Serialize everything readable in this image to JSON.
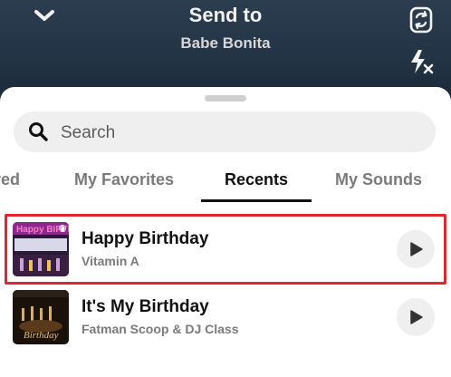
{
  "header": {
    "title": "Send to",
    "subtitle": "Babe Bonita",
    "icons": [
      "chevron-down-icon",
      "flip-camera-icon",
      "flash-off-icon"
    ]
  },
  "search": {
    "placeholder": "Search",
    "value": ""
  },
  "tabs": [
    {
      "label": "red",
      "active": false
    },
    {
      "label": "My Favorites",
      "active": false
    },
    {
      "label": "Recents",
      "active": true
    },
    {
      "label": "My Sounds",
      "active": false
    }
  ],
  "tracks": [
    {
      "title": "Happy Birthday",
      "artist": "Vitamin A",
      "selected": true,
      "thumb_text": "Happy BIRTHDAY"
    },
    {
      "title": "It's My Birthday",
      "artist": "Fatman Scoop & DJ Class",
      "selected": false,
      "thumb_text": "Birthday"
    }
  ],
  "colors": {
    "highlight": "#e3252d",
    "header_bg": "#233446",
    "sheet_bg": "#ffffff"
  }
}
